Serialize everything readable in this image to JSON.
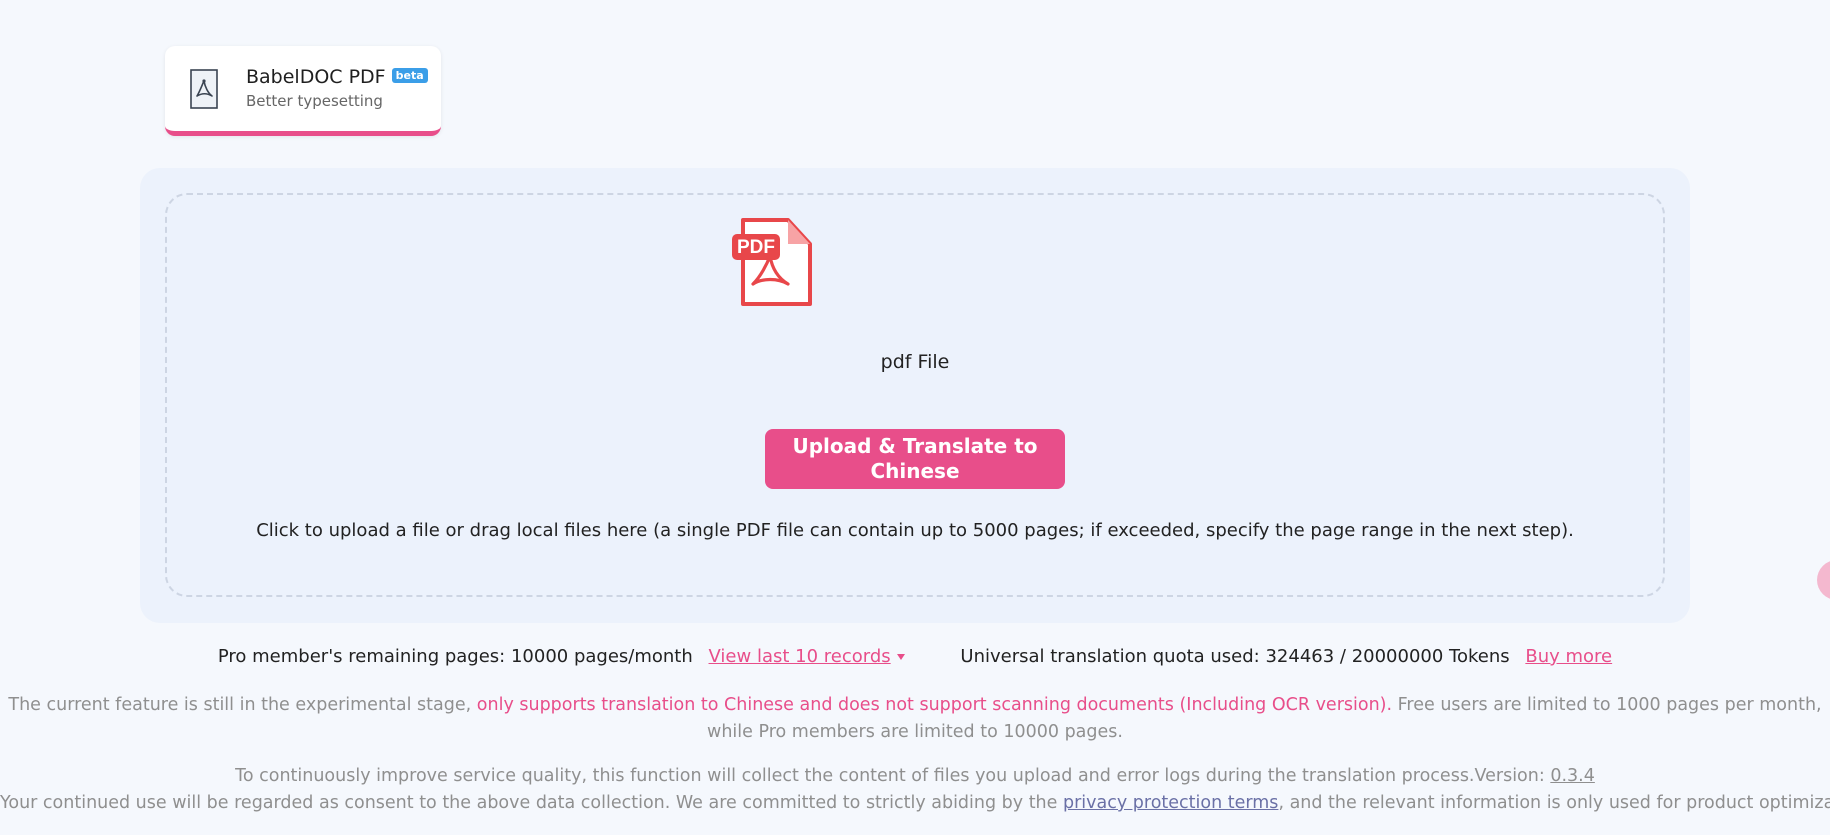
{
  "tab": {
    "title": "BabelDOC PDF",
    "badge": "beta",
    "subtitle": "Better typesetting",
    "icon": "pdf-document-icon",
    "accent_color": "#e84e8a"
  },
  "upload": {
    "file_icon": "pdf-file-icon",
    "file_icon_text": "PDF",
    "file_type_label": "pdf File",
    "button_label": "Upload & Translate to Chinese",
    "hint": "Click to upload a file or drag local files here (a single PDF file can contain up to 5000 pages; if exceeded, specify the page range in the next step)."
  },
  "quota": {
    "pages_label": "Pro member's remaining pages: 10000 pages/month",
    "records_link": "View last 10 records",
    "tokens_label": "Universal translation quota used: 324463 / 20000000 Tokens",
    "buy_more": "Buy more"
  },
  "notice": {
    "prefix": "The current feature is still in the experimental stage,",
    "highlight": "only supports translation to Chinese and does not support scanning documents (Including OCR version).",
    "suffix": "Free users are limited to 1000 pages per month, while Pro members are limited to 10000 pages."
  },
  "collection": {
    "line1": "To continuously improve service quality, this function will collect the content of files you upload and error logs during the translation process.Version:",
    "version": "0.3.4",
    "line2_prefix": "Your continued use will be regarded as consent to the above data collection. We are committed to strictly abiding by the",
    "privacy_link": "privacy protection terms",
    "line2_suffix": ", and the relevant information is only used for product optimization."
  },
  "colors": {
    "primary": "#e84e8a",
    "pdf_red": "#e8474a",
    "background": "#f5f8fd",
    "panel": "#ecf2fc"
  }
}
